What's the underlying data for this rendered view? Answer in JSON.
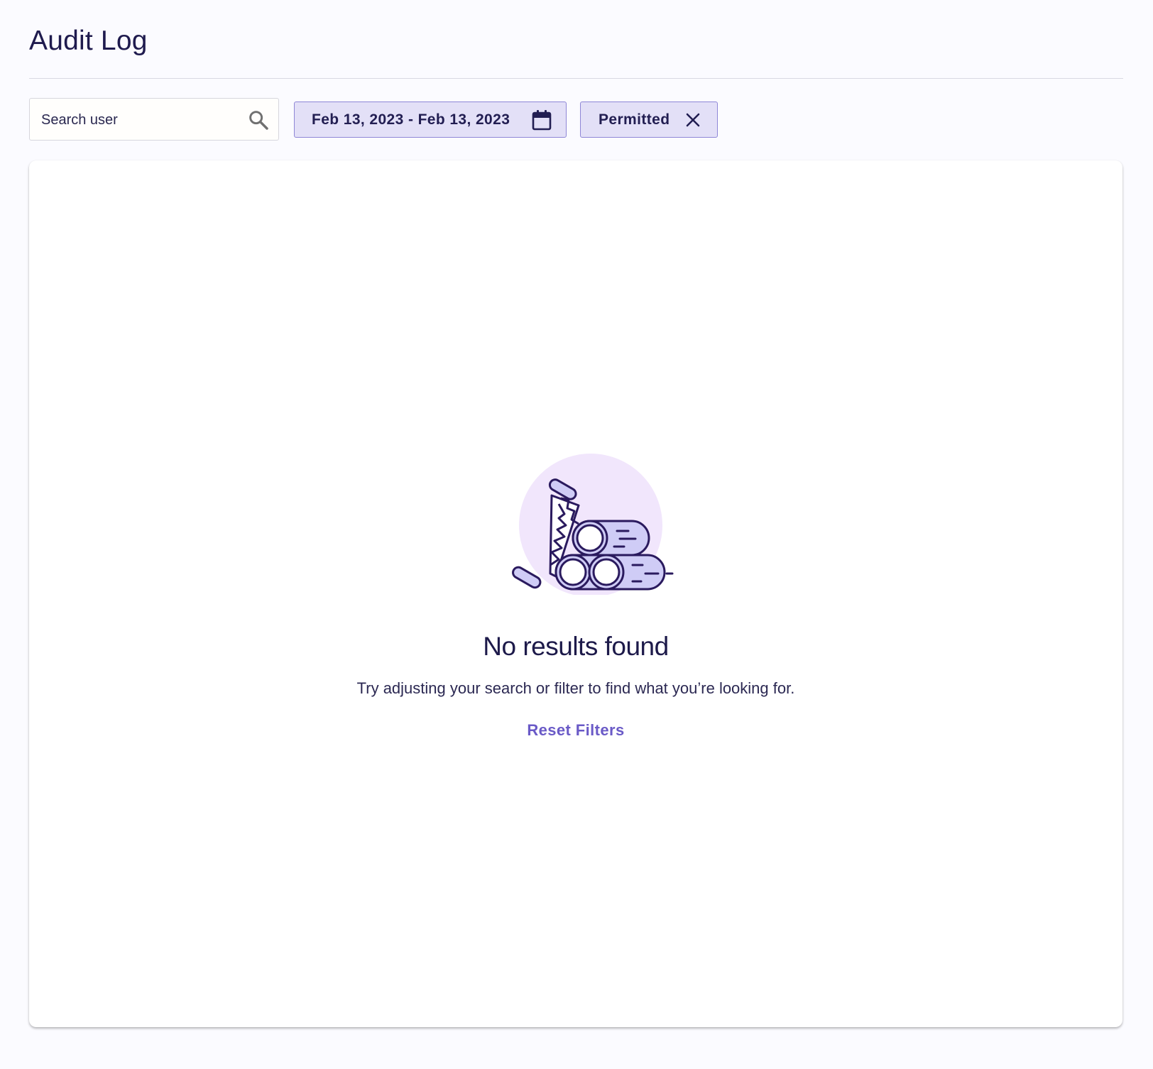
{
  "header": {
    "title": "Audit Log"
  },
  "filters": {
    "search": {
      "value": "",
      "placeholder": "Search user",
      "icon": "search-icon"
    },
    "date_range": {
      "label": "Feb 13, 2023 - Feb 13, 2023",
      "icon": "calendar-icon"
    },
    "status": {
      "label": "Permitted",
      "icon": "close-icon"
    }
  },
  "results": {
    "illustration": "logs-and-saw-illustration",
    "empty_title": "No results found",
    "empty_message": "Try adjusting your search or filter to find what you’re looking for.",
    "reset_label": "Reset Filters"
  },
  "colors": {
    "page_background": "#fbfbff",
    "text": "#1d1a4a",
    "chip_background": "#e3e0f7",
    "chip_border": "#8e86d6",
    "link": "#6a5ac7",
    "illustration_circle": "#f1e6fc",
    "illustration_fill": "#cfccf6"
  }
}
